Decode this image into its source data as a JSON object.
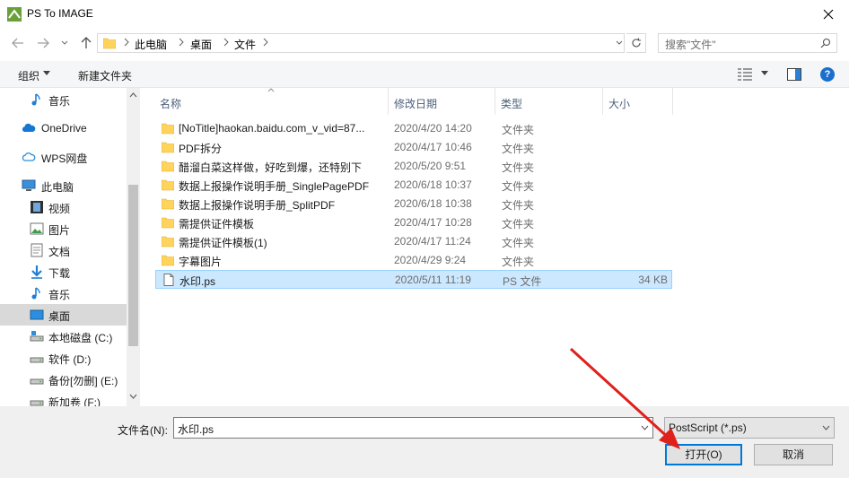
{
  "window": {
    "title": "PS To IMAGE"
  },
  "breadcrumb": [
    "此电脑",
    "桌面",
    "文件"
  ],
  "search": {
    "placeholder": "搜索\"文件\""
  },
  "toolbar": {
    "organize": "组织",
    "new_folder": "新建文件夹"
  },
  "leftnav": {
    "items": [
      {
        "label": "音乐",
        "icon": "music-note-icon"
      },
      {
        "label": "OneDrive",
        "icon": "cloud-icon"
      },
      {
        "label": "WPS网盘",
        "icon": "cloud-outline-icon"
      },
      {
        "label": "此电脑",
        "icon": "computer-icon"
      },
      {
        "label": "视频",
        "icon": "video-icon"
      },
      {
        "label": "图片",
        "icon": "picture-icon"
      },
      {
        "label": "文档",
        "icon": "document-icon"
      },
      {
        "label": "下载",
        "icon": "download-icon"
      },
      {
        "label": "音乐",
        "icon": "music-note-icon"
      },
      {
        "label": "桌面",
        "icon": "desktop-icon"
      },
      {
        "label": "本地磁盘 (C:)",
        "icon": "drive-icon"
      },
      {
        "label": "软件 (D:)",
        "icon": "drive-icon"
      },
      {
        "label": "备份[勿删] (E:)",
        "icon": "drive-icon"
      },
      {
        "label": "新加卷 (F:)",
        "icon": "drive-icon"
      }
    ]
  },
  "filelist": {
    "columns": {
      "name": "名称",
      "date": "修改日期",
      "type": "类型",
      "size": "大小"
    },
    "rows": [
      {
        "name": "[NoTitle]haokan.baidu.com_v_vid=87...",
        "date": "2020/4/20 14:20",
        "type": "文件夹",
        "size": ""
      },
      {
        "name": "PDF拆分",
        "date": "2020/4/17 10:46",
        "type": "文件夹",
        "size": ""
      },
      {
        "name": "醋溜白菜这样做，好吃到爆，还特别下",
        "date": "2020/5/20 9:51",
        "type": "文件夹",
        "size": ""
      },
      {
        "name": "数据上报操作说明手册_SinglePagePDF",
        "date": "2020/6/18 10:37",
        "type": "文件夹",
        "size": ""
      },
      {
        "name": "数据上报操作说明手册_SplitPDF",
        "date": "2020/6/18 10:38",
        "type": "文件夹",
        "size": ""
      },
      {
        "name": "需提供证件模板",
        "date": "2020/4/17 10:28",
        "type": "文件夹",
        "size": ""
      },
      {
        "name": "需提供证件模板(1)",
        "date": "2020/4/17 11:24",
        "type": "文件夹",
        "size": ""
      },
      {
        "name": "字幕图片",
        "date": "2020/4/29 9:24",
        "type": "文件夹",
        "size": ""
      },
      {
        "name": "水印.ps",
        "date": "2020/5/11 11:19",
        "type": "PS 文件",
        "size": "34 KB"
      }
    ]
  },
  "bottom": {
    "filename_label": "文件名(N):",
    "filename_value": "水印.ps",
    "filetype_value": "PostScript (*.ps)",
    "open_label": "打开(O)",
    "cancel_label": "取消"
  },
  "colors": {
    "accent": "#0078d7",
    "selection": "#cce8ff",
    "folder": "#ffd35c",
    "arrow": "#e0201b"
  }
}
